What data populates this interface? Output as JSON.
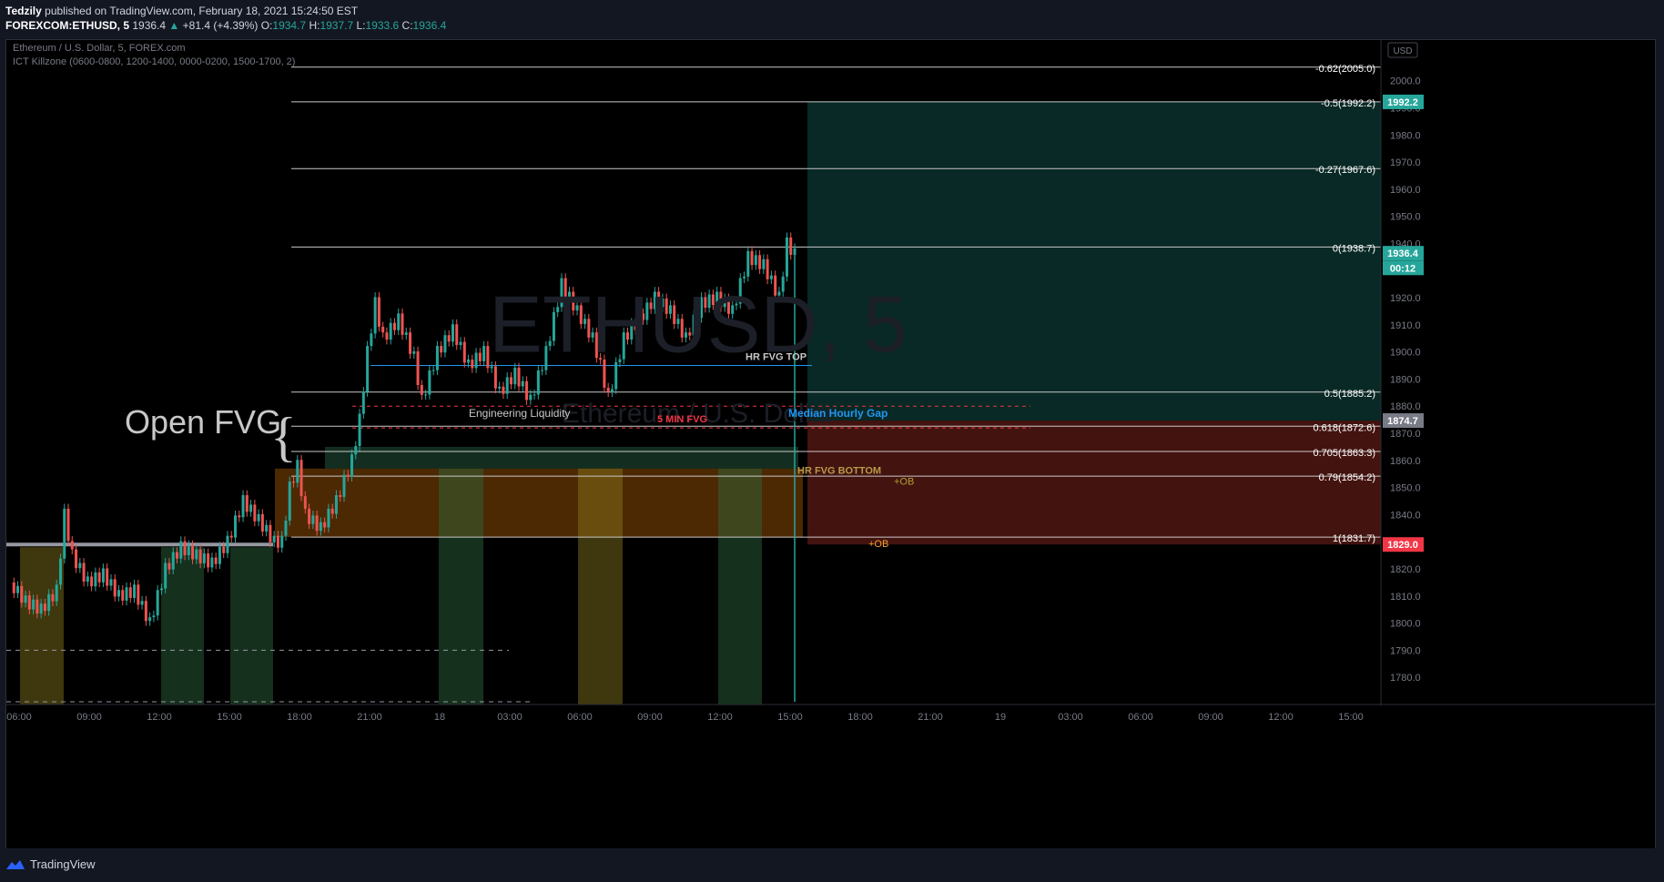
{
  "header": {
    "author": "Tedzily",
    "published": "published on TradingView.com, February 18, 2021 15:24:50 EST",
    "symbol": "FOREXCOM:ETHUSD, 5",
    "last": "1936.4",
    "change": "+81.4 (+4.39%)",
    "o_label": "O:",
    "o": "1934.7",
    "h_label": "H:",
    "h": "1937.7",
    "l_label": "L:",
    "l": "1933.6",
    "c_label": "C:",
    "c": "1936.4"
  },
  "legend": {
    "title": "Ethereum / U.S. Dollar, 5, FOREX.com",
    "indicator": "ICT Killzone (0600-0800, 1200-1400, 0000-0200, 1500-1700, 2)",
    "currency_button": "USD"
  },
  "watermark": {
    "symbol": "ETHUSD, 5",
    "name": "Ethereum / U.S. Dollar"
  },
  "colors": {
    "up": "#26a69a",
    "down": "#ef5350",
    "fib": "#c8c8c8",
    "blue": "#2196f3",
    "red": "#f23645",
    "killzone_gold": "#8b7a1c",
    "killzone_green": "#2e6b3e"
  },
  "chart_data": {
    "type": "candlestick",
    "symbol": "FOREXCOM:ETHUSD",
    "interval": "5",
    "ylim": [
      1770,
      2015
    ],
    "y_ticks": [
      1780,
      1790,
      1800,
      1810,
      1820,
      1830,
      1840,
      1850,
      1860,
      1870,
      1880,
      1890,
      1900,
      1910,
      1920,
      1930,
      1940,
      1950,
      1960,
      1970,
      1980,
      1990,
      2000
    ],
    "x_ticks": [
      "06:00",
      "09:00",
      "12:00",
      "15:00",
      "18:00",
      "21:00",
      "18",
      "03:00",
      "06:00",
      "09:00",
      "12:00",
      "15:00",
      "18:00",
      "21:00",
      "19",
      "03:00",
      "06:00",
      "09:00",
      "12:00",
      "15:00"
    ],
    "price_path": [
      [
        0,
        1815
      ],
      [
        2,
        1808
      ],
      [
        4,
        1805
      ],
      [
        6,
        1812
      ],
      [
        7,
        1840
      ],
      [
        8,
        1825
      ],
      [
        10,
        1815
      ],
      [
        12,
        1818
      ],
      [
        14,
        1810
      ],
      [
        16,
        1812
      ],
      [
        18,
        1800
      ],
      [
        20,
        1820
      ],
      [
        22,
        1828
      ],
      [
        24,
        1825
      ],
      [
        26,
        1822
      ],
      [
        28,
        1830
      ],
      [
        30,
        1845
      ],
      [
        32,
        1838
      ],
      [
        34,
        1830
      ],
      [
        35,
        1830
      ],
      [
        36,
        1850
      ],
      [
        37,
        1858
      ],
      [
        38,
        1840
      ],
      [
        40,
        1835
      ],
      [
        42,
        1845
      ],
      [
        44,
        1860
      ],
      [
        45,
        1875
      ],
      [
        46,
        1900
      ],
      [
        47,
        1918
      ],
      [
        48,
        1905
      ],
      [
        50,
        1912
      ],
      [
        52,
        1898
      ],
      [
        53,
        1882
      ],
      [
        55,
        1900
      ],
      [
        57,
        1908
      ],
      [
        59,
        1895
      ],
      [
        61,
        1900
      ],
      [
        63,
        1885
      ],
      [
        65,
        1892
      ],
      [
        67,
        1882
      ],
      [
        69,
        1900
      ],
      [
        71,
        1925
      ],
      [
        73,
        1915
      ],
      [
        75,
        1905
      ],
      [
        76,
        1895
      ],
      [
        77,
        1883
      ],
      [
        79,
        1905
      ],
      [
        81,
        1912
      ],
      [
        83,
        1920
      ],
      [
        85,
        1915
      ],
      [
        87,
        1905
      ],
      [
        89,
        1918
      ],
      [
        91,
        1920
      ],
      [
        93,
        1915
      ],
      [
        95,
        1935
      ],
      [
        97,
        1932
      ],
      [
        99,
        1920
      ],
      [
        100,
        1940
      ],
      [
        101,
        1936
      ]
    ],
    "fib_levels": [
      {
        "label": "-0.62(2005.0)",
        "value": 2005.0
      },
      {
        "label": "-0.5(1992.2)",
        "value": 1992.2
      },
      {
        "label": "-0.27(1967.6)",
        "value": 1967.6
      },
      {
        "label": "0(1938.7)",
        "value": 1938.7
      },
      {
        "label": "0.5(1885.2)",
        "value": 1885.2
      },
      {
        "label": "0.618(1872.6)",
        "value": 1872.6
      },
      {
        "label": "0.705(1863.3)",
        "value": 1863.3
      },
      {
        "label": "0.79(1854.2)",
        "value": 1854.2
      },
      {
        "label": "1(1831.7)",
        "value": 1831.7
      }
    ],
    "price_tags": [
      {
        "label": "1992.2",
        "value": 1992.2,
        "color": "#26a69a"
      },
      {
        "label": "1936.4",
        "value": 1936.4,
        "color": "#26a69a"
      },
      {
        "label": "00:12",
        "value": 1931.0,
        "color": "#26a69a"
      },
      {
        "label": "1874.7",
        "value": 1874.7,
        "color": "#787b86"
      },
      {
        "label": "1829.0",
        "value": 1829.0,
        "color": "#f23645"
      }
    ],
    "annotations": [
      {
        "text": "Open FVG",
        "value": 1870
      },
      {
        "text": "HR FVG TOP",
        "value": 1897
      },
      {
        "text": "Engineering Liquidity",
        "value": 1876
      },
      {
        "text": "5 MIN FVG",
        "value": 1874
      },
      {
        "text": "Median Hourly Gap",
        "value": 1876
      },
      {
        "text": "HR FVG BOTTOM",
        "value": 1855
      },
      {
        "text": "+OB",
        "value": 1851
      },
      {
        "text": "+OB",
        "value": 1828
      }
    ],
    "zones": {
      "long_target_top": 1992.2,
      "long_target_bottom": 1874.7,
      "stop_top": 1874.7,
      "stop_bottom": 1829.0
    }
  },
  "footer": {
    "brand": "TradingView"
  }
}
